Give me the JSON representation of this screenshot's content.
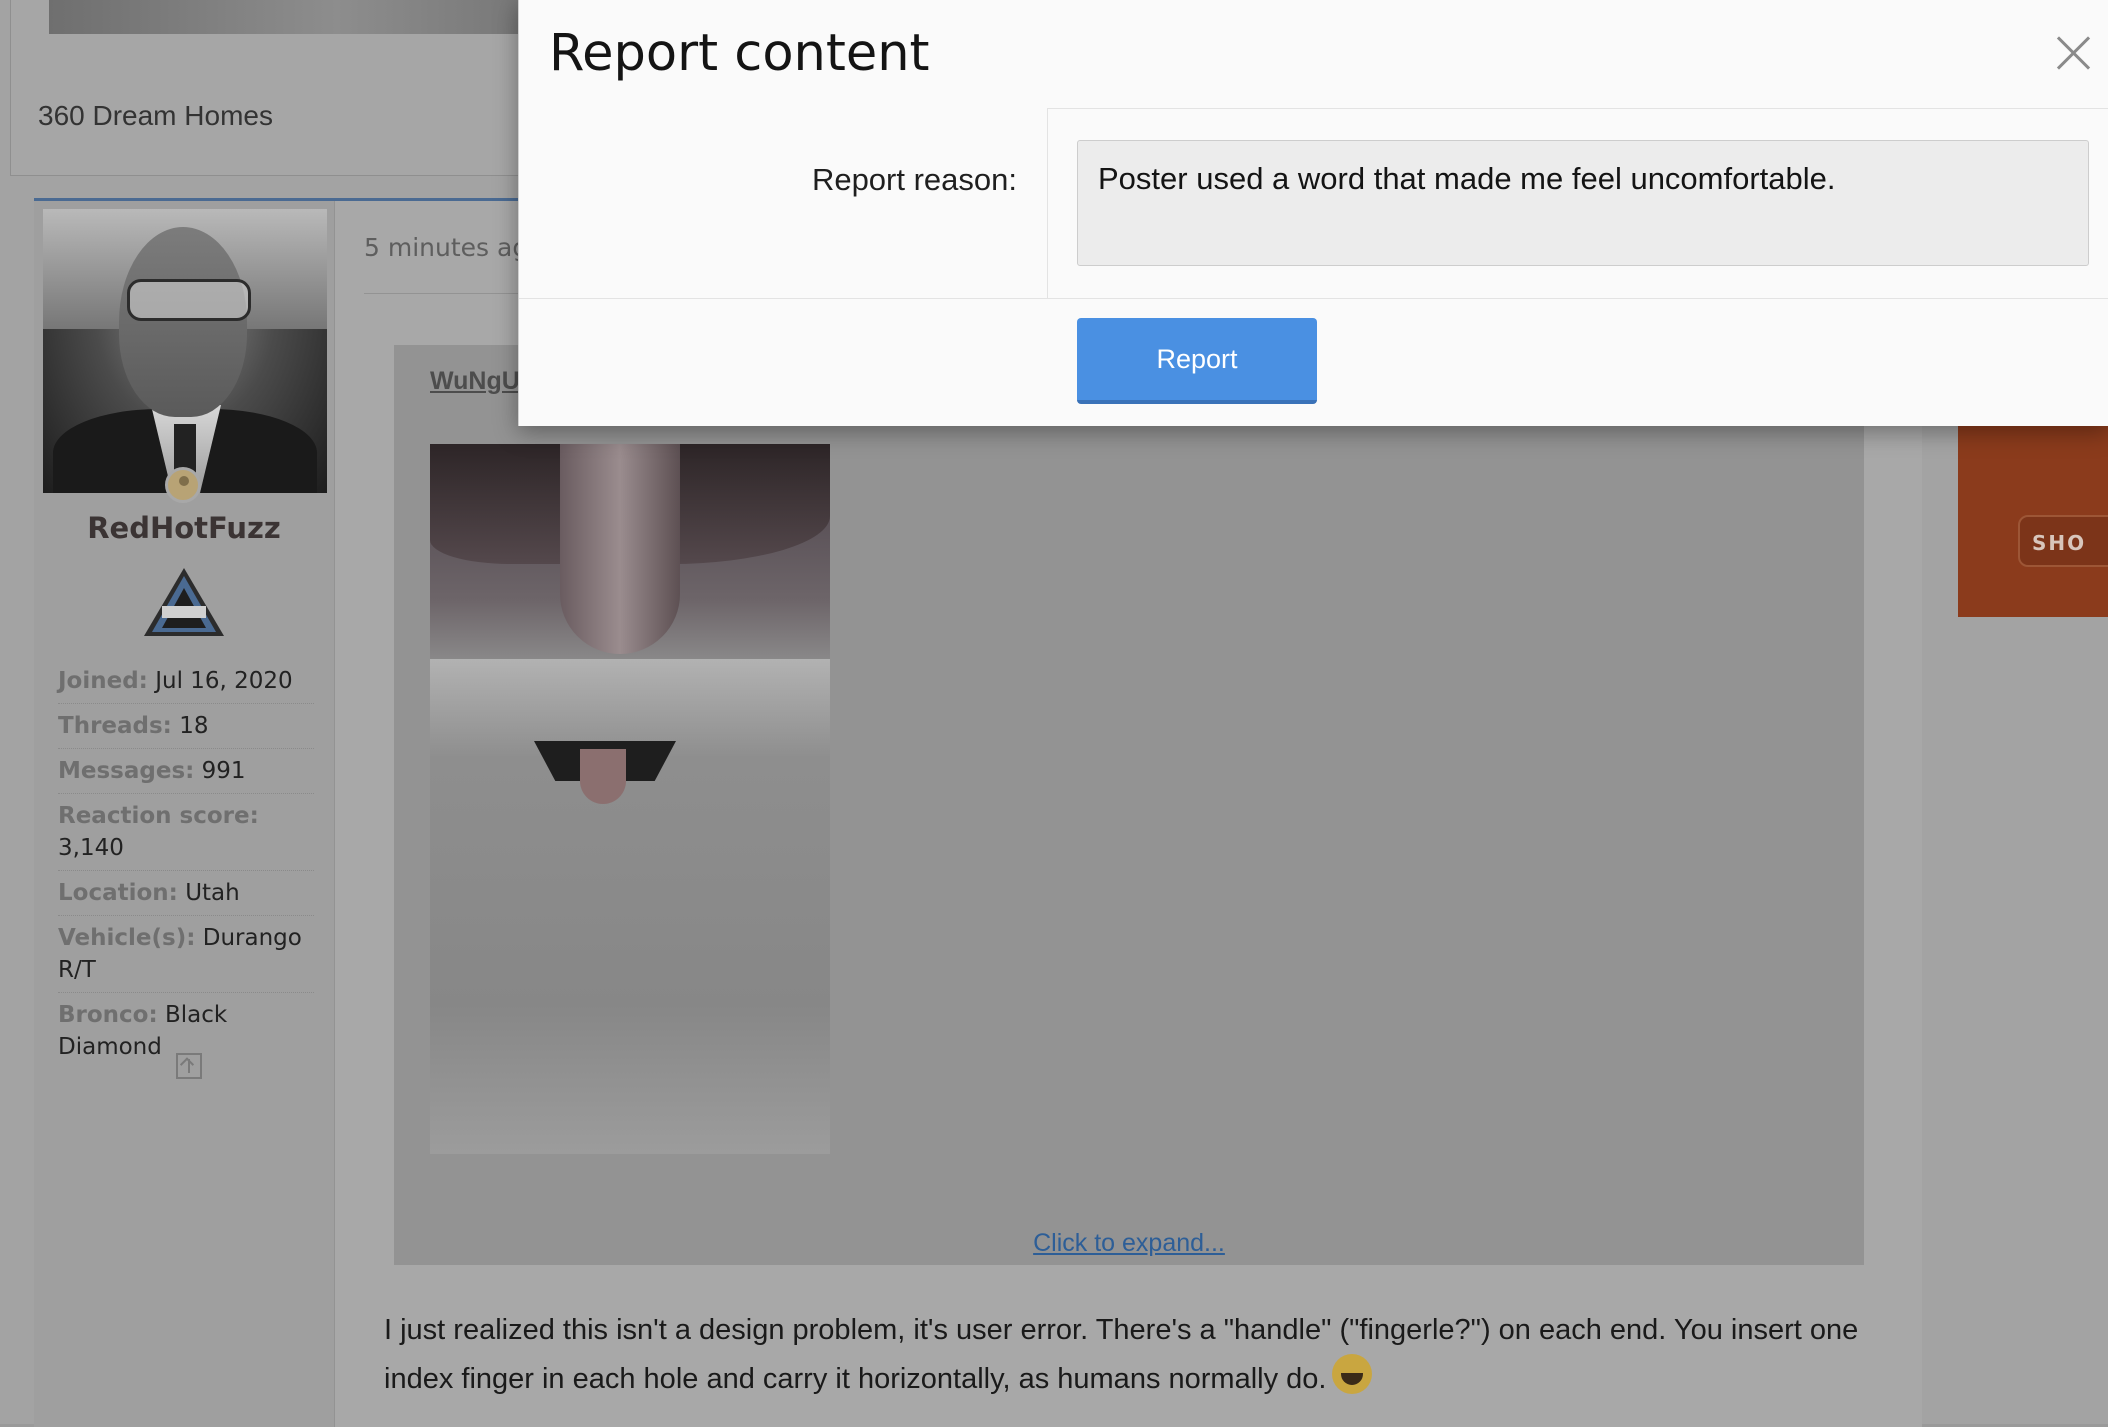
{
  "background": {
    "site_name": "360 Dream Homes",
    "post": {
      "timestamp": "5 minutes ag",
      "user": {
        "username": "RedHotFuzz",
        "badge_label": "BLACK DIAMOND",
        "stats": [
          {
            "key": "Joined:",
            "value": "Jul 16, 2020"
          },
          {
            "key": "Threads:",
            "value": "18"
          },
          {
            "key": "Messages:",
            "value": "991"
          },
          {
            "key": "Reaction score:",
            "value": "3,140"
          },
          {
            "key": "Location:",
            "value": "Utah"
          },
          {
            "key": "Vehicle(s):",
            "value": "Durango R/T"
          },
          {
            "key": "Bronco:",
            "value": "Black Diamond"
          }
        ]
      },
      "quote": {
        "author": "WuNgU",
        "expand_link": "Click to expand..."
      },
      "body": "I just realized this isn't a design problem, it's user error. There's a \"handle\" (\"fingerle?\") on each end. You insert one index finger in each hole and carry it horizontally, as humans normally do.",
      "emoji_icon": "laughing-tears-emoji"
    },
    "ad": {
      "button_text": "SHO"
    }
  },
  "modal": {
    "title": "Report content",
    "close_icon": "close-icon",
    "reason_label": "Report reason:",
    "reason_value": "Poster used a word that made me feel uncomfortable.",
    "submit_label": "Report"
  },
  "colors": {
    "accent_button": "#4a90e2",
    "overlay_dim": "#9a9a9a",
    "link": "#2d5e97"
  }
}
